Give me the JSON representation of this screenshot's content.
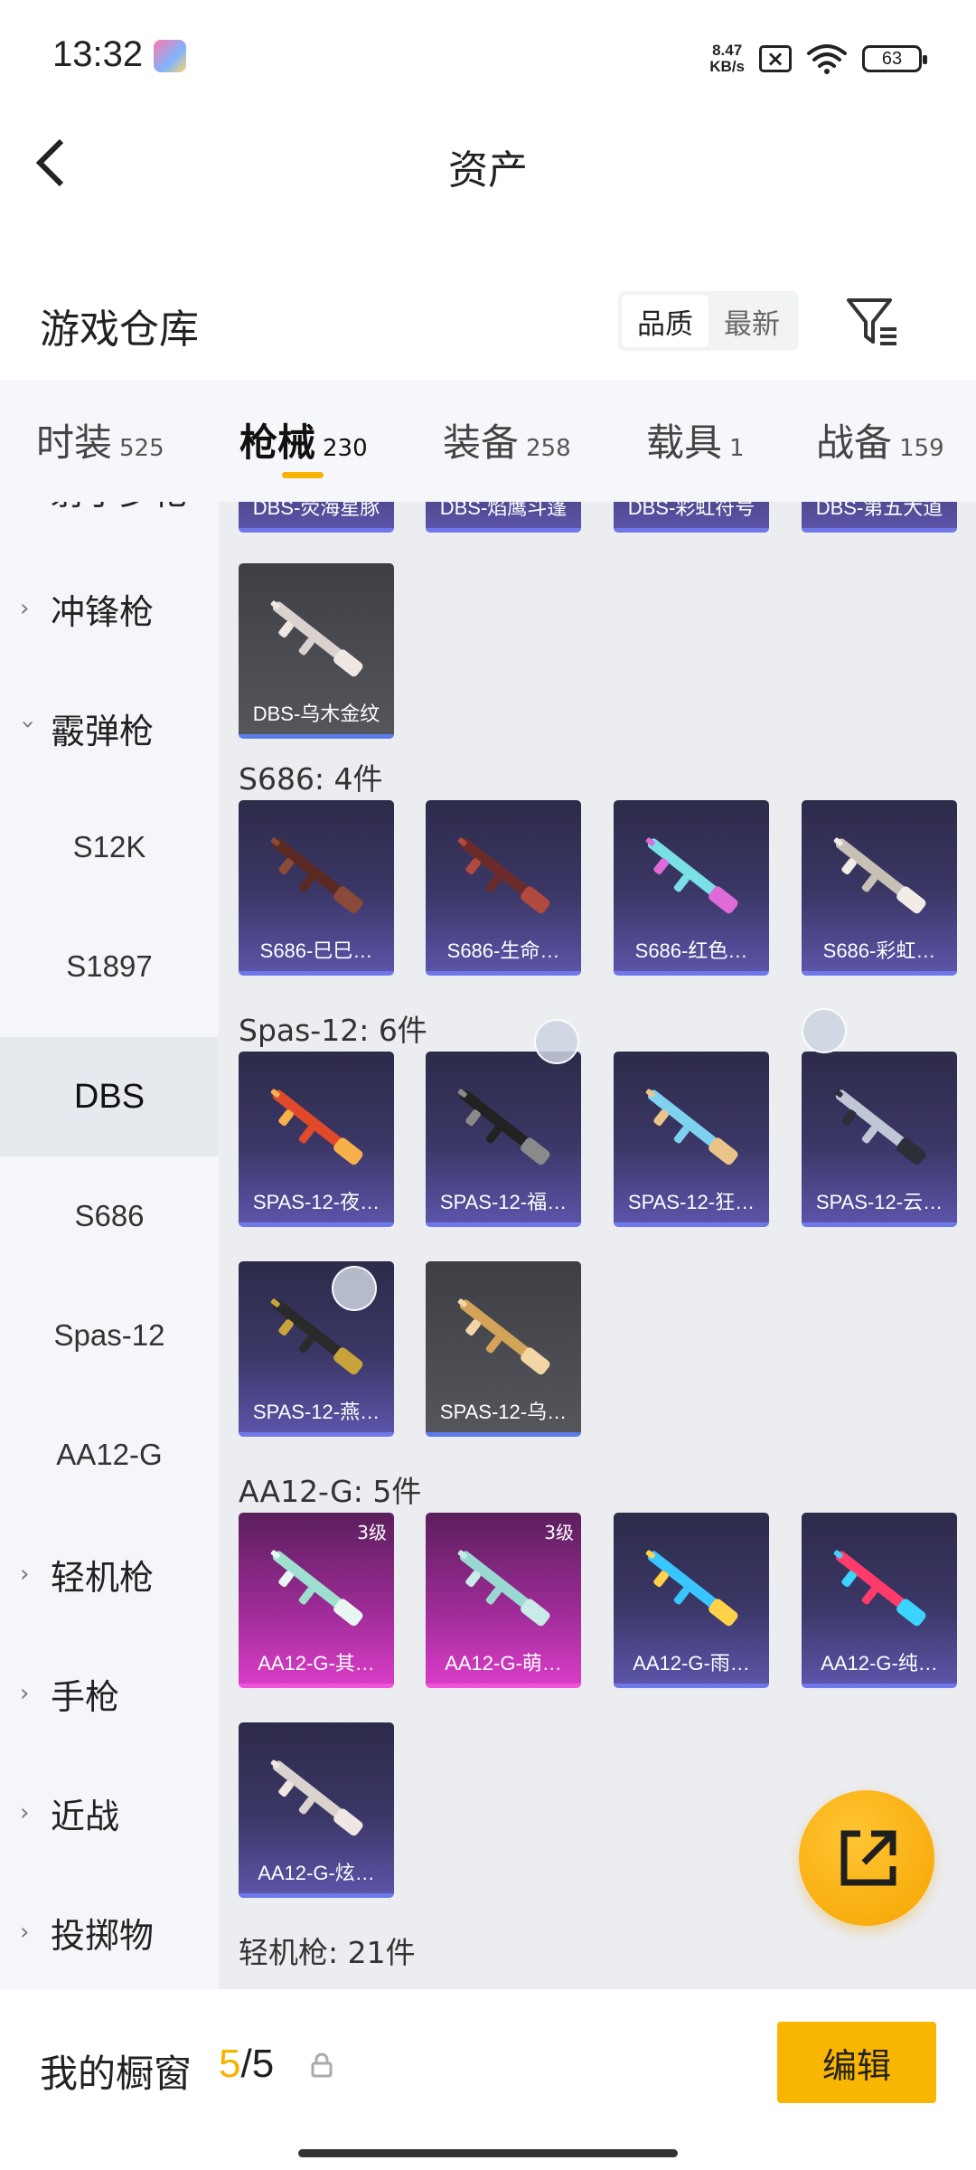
{
  "status_bar": {
    "time": "13:32",
    "net_speed_value": "8.47",
    "net_speed_unit": "KB/s",
    "battery": "63"
  },
  "nav": {
    "title": "资产"
  },
  "warehouse": {
    "title": "游戏仓库",
    "sort_options": [
      "品质",
      "最新"
    ],
    "active_sort": "品质"
  },
  "tabs": [
    {
      "label": "时装",
      "count": "525"
    },
    {
      "label": "枪械",
      "count": "230",
      "active": true
    },
    {
      "label": "装备",
      "count": "258"
    },
    {
      "label": "载具",
      "count": "1"
    },
    {
      "label": "战备",
      "count": "159"
    }
  ],
  "sidebar": {
    "partial_top": "射手步枪",
    "items": [
      {
        "type": "category",
        "label": "冲锋枪",
        "expanded": false
      },
      {
        "type": "category",
        "label": "霰弹枪",
        "expanded": true
      },
      {
        "type": "sub",
        "label": "S12K"
      },
      {
        "type": "sub",
        "label": "S1897"
      },
      {
        "type": "sub",
        "label": "DBS",
        "active": true
      },
      {
        "type": "sub",
        "label": "S686"
      },
      {
        "type": "sub",
        "label": "Spas-12"
      },
      {
        "type": "sub",
        "label": "AA12-G"
      },
      {
        "type": "category",
        "label": "轻机枪",
        "expanded": false
      },
      {
        "type": "category",
        "label": "手枪",
        "expanded": false
      },
      {
        "type": "category",
        "label": "近战",
        "expanded": false
      },
      {
        "type": "category",
        "label": "投掷物",
        "expanded": false
      }
    ]
  },
  "content": {
    "partial_row": [
      "DBS-荧海星豚",
      "DBS-焰鹰斗篷",
      "DBS-彩虹符号",
      "DBS-第五大道"
    ],
    "dbs_extra": [
      {
        "name": "DBS-乌木金纹",
        "rarity": "grey"
      }
    ],
    "sections": [
      {
        "title": "S686: 4件",
        "items": [
          {
            "name": "S686-巳巳…",
            "rarity": "blue"
          },
          {
            "name": "S686-生命…",
            "rarity": "blue"
          },
          {
            "name": "S686-红色…",
            "rarity": "blue"
          },
          {
            "name": "S686-彩虹…",
            "rarity": "blue"
          }
        ]
      },
      {
        "title": "Spas-12: 6件",
        "items": [
          {
            "name": "SPAS-12-夜…",
            "rarity": "blue"
          },
          {
            "name": "SPAS-12-福…",
            "rarity": "blue"
          },
          {
            "name": "SPAS-12-狂…",
            "rarity": "blue"
          },
          {
            "name": "SPAS-12-云…",
            "rarity": "blue"
          },
          {
            "name": "SPAS-12-燕…",
            "rarity": "blue"
          },
          {
            "name": "SPAS-12-乌…",
            "rarity": "grey"
          }
        ]
      },
      {
        "title": "AA12-G: 5件",
        "items": [
          {
            "name": "AA12-G-其…",
            "rarity": "pink",
            "level": "3级"
          },
          {
            "name": "AA12-G-萌…",
            "rarity": "pink",
            "level": "3级"
          },
          {
            "name": "AA12-G-雨…",
            "rarity": "blue"
          },
          {
            "name": "AA12-G-纯…",
            "rarity": "blue"
          },
          {
            "name": "AA12-G-炫…",
            "rarity": "blue"
          }
        ]
      },
      {
        "title": "轻机枪: 21件",
        "items": []
      }
    ]
  },
  "bottom_bar": {
    "title": "我的橱窗",
    "current": "5",
    "separator": "/",
    "total": "5",
    "edit_label": "编辑"
  },
  "colors": {
    "accent": "#f6b400",
    "blue_rarity": "#6e78e8",
    "pink_rarity": "#ef53d9",
    "grey_rarity": "#5b7bea"
  },
  "icons": {
    "back": "chevron-left-icon",
    "filter": "filter-icon",
    "share": "share-external-icon",
    "lock": "lock-icon"
  }
}
